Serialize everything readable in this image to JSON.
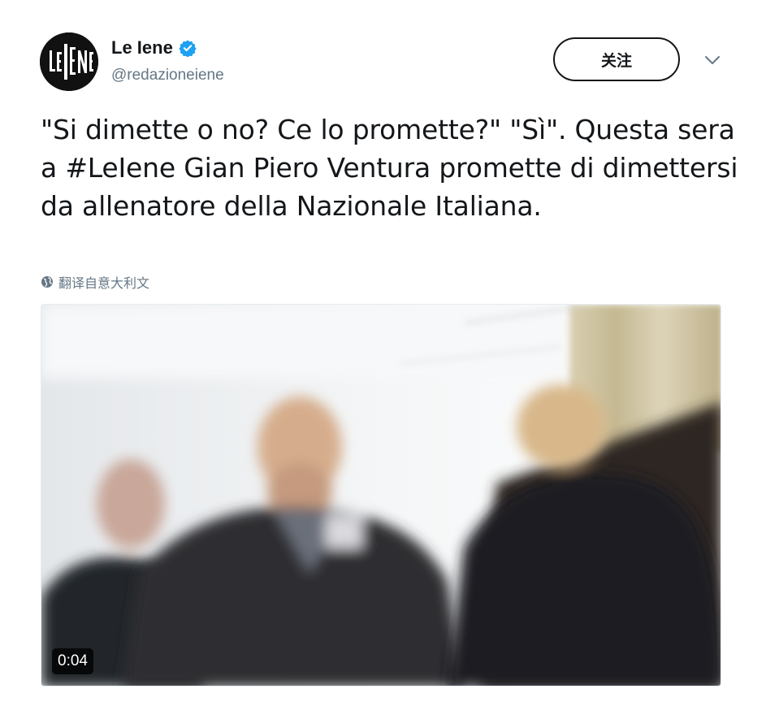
{
  "author": {
    "display_name": "Le Iene",
    "handle": "@redazioneiene",
    "verified": true,
    "avatar_text": "LE IENE"
  },
  "header": {
    "follow_label": "关注",
    "menu_icon": "chevron-down-icon"
  },
  "tweet": {
    "text_before_hashtag": "\"Si dimette o no? Ce lo promette?\" \"Sì\". Questa sera a ",
    "hashtag": "#LeIene",
    "text_after_hashtag": " Gian Piero Ventura promette di dimettersi da allenatore della Nazionale Italiana."
  },
  "translate": {
    "icon": "globe-icon",
    "label": "翻译自意大利文"
  },
  "media": {
    "type": "video",
    "duration": "0:04"
  },
  "colors": {
    "text": "#14171a",
    "secondary": "#657786",
    "verified": "#1da1f2"
  }
}
